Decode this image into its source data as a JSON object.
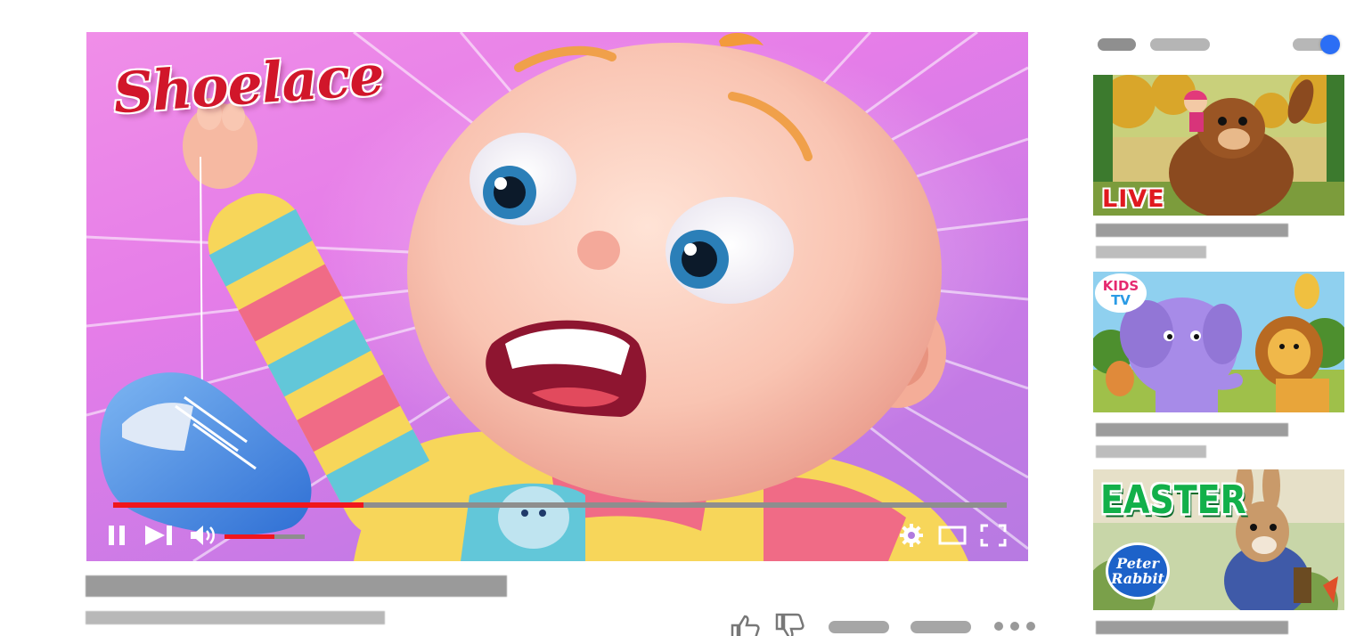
{
  "player": {
    "title_art_text": "Shoelace",
    "progress": 0.28,
    "volume": 0.62,
    "controls": {
      "pause_icon": "pause-icon",
      "next_icon": "skip-next-icon",
      "volume_icon": "volume-icon",
      "settings_icon": "gear-icon",
      "theater_icon": "theater-mode-icon",
      "fullscreen_icon": "fullscreen-icon"
    },
    "accent": "#f0161c"
  },
  "actions": {
    "like_icon": "thumbs-up-icon",
    "dislike_icon": "thumbs-down-icon",
    "more_icon": "more-horizontal-icon"
  },
  "sidebar": {
    "autoplay_on": true,
    "toggle_color": "#2b6ef5",
    "videos": [
      {
        "badge": "LIVE"
      },
      {
        "badge_line1": "KIDS",
        "badge_line2": "TV"
      },
      {
        "title_text": "EASTER",
        "badge_line1": "Peter",
        "badge_line2": "Rabbit"
      }
    ]
  }
}
